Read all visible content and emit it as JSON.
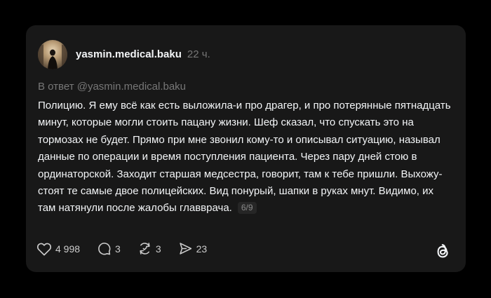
{
  "post": {
    "username": "yasmin.medical.baku",
    "time": "22 ч.",
    "reply_to": "В ответ @yasmin.medical.baku",
    "text": "Полицию. Я ему всё как есть выложила-и про драгер, и про потерянные пятнадцать минут, которые могли стоить пацану жизни. Шеф сказал, что спускать это на тормозах не будет. Прямо при мне звонил кому-то и описывал ситуацию, называл данные по операции и время поступления пациента. Через пару дней стою в ординаторской. Заходит старшая медсестра, говорит, там к тебе пришли. Выхожу-стоят те самые двое полицейских. Вид понурый, шапки в руках мнут. Видимо, их там натянули после жалобы главврача.",
    "thread_counter": "6/9"
  },
  "actions": {
    "likes": "4 998",
    "comments": "3",
    "reposts": "3",
    "shares": "23"
  },
  "icons": {
    "like": "heart-icon",
    "comment": "comment-icon",
    "repost": "repost-icon",
    "share": "share-icon",
    "logo": "threads-logo-icon"
  },
  "colors": {
    "background": "#000000",
    "card": "#181818",
    "text": "#f3f5f7",
    "muted": "#777777"
  }
}
